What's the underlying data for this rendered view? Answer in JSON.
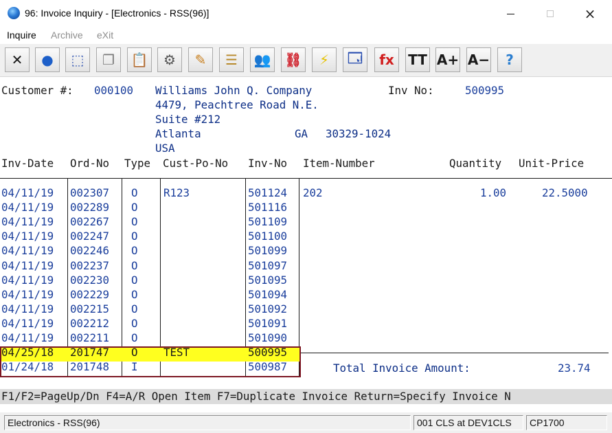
{
  "window": {
    "title": "96: Invoice Inquiry - [Electronics - RSS(96)]",
    "controls": {
      "minimize": "minimize",
      "maximize": "maximize",
      "close": "×"
    }
  },
  "menu": {
    "items": [
      {
        "label": "Inquire",
        "enabled": true
      },
      {
        "label": "Archive",
        "enabled": false
      },
      {
        "label": "eXit",
        "enabled": false
      }
    ]
  },
  "toolbar": {
    "buttons": [
      {
        "icon": "close-x-icon",
        "glyph": "✕",
        "color": "#1a1a1a"
      },
      {
        "icon": "globe-icon",
        "glyph": "●",
        "color": "#1d5fc9"
      },
      {
        "icon": "select-box-icon",
        "glyph": "⬚",
        "color": "#2a4fb0"
      },
      {
        "icon": "copy-icon",
        "glyph": "❐",
        "color": "#7a7a7a"
      },
      {
        "icon": "paste-icon",
        "glyph": "📋",
        "color": "#7a7a7a"
      },
      {
        "icon": "gear-icon",
        "glyph": "⚙",
        "color": "#555555"
      },
      {
        "icon": "edit-pencil-icon",
        "glyph": "✎",
        "color": "#c77d1a"
      },
      {
        "icon": "notepad-icon",
        "glyph": "☰",
        "color": "#b88a2c"
      },
      {
        "icon": "users-icon",
        "glyph": "👥",
        "color": "#2c7fd0"
      },
      {
        "icon": "link-icon",
        "glyph": "⛓",
        "color": "#d0202b"
      },
      {
        "icon": "lightning-icon",
        "glyph": "⚡",
        "color": "#e6c200"
      },
      {
        "icon": "window-lightning-icon",
        "glyph": "🗔",
        "color": "#2a4fb0"
      },
      {
        "icon": "function-fx-icon",
        "glyph": "fx",
        "color": "#d11f1f"
      },
      {
        "icon": "font-tt-icon",
        "glyph": "TT",
        "color": "#1a1a1a"
      },
      {
        "icon": "font-increase-icon",
        "glyph": "A+",
        "color": "#1a1a1a"
      },
      {
        "icon": "font-decrease-icon",
        "glyph": "A−",
        "color": "#1a1a1a"
      },
      {
        "icon": "help-icon",
        "glyph": "?",
        "color": "#2c7fd0"
      }
    ]
  },
  "customer": {
    "label": "Customer #:",
    "number": "000100",
    "name": "Williams John Q. Company",
    "address1": "4479, Peachtree Road N.E.",
    "address2": "Suite #212",
    "city": "Atlanta",
    "state": "GA",
    "zip": "30329-1024",
    "country": "USA"
  },
  "invoice": {
    "label": "Inv No:",
    "number": "500995"
  },
  "columns": {
    "inv_date": "Inv-Date",
    "ord_no": "Ord-No",
    "type": "Type",
    "cust_po_no": "Cust-Po-No",
    "inv_no": "Inv-No",
    "item_number": "Item-Number",
    "quantity": "Quantity",
    "unit_price": "Unit-Price"
  },
  "rows": [
    {
      "inv_date": "04/11/19",
      "ord_no": "002307",
      "type": "O",
      "cust_po_no": "R123",
      "inv_no": "501124"
    },
    {
      "inv_date": "04/11/19",
      "ord_no": "002289",
      "type": "O",
      "cust_po_no": "",
      "inv_no": "501116"
    },
    {
      "inv_date": "04/11/19",
      "ord_no": "002267",
      "type": "O",
      "cust_po_no": "",
      "inv_no": "501109"
    },
    {
      "inv_date": "04/11/19",
      "ord_no": "002247",
      "type": "O",
      "cust_po_no": "",
      "inv_no": "501100"
    },
    {
      "inv_date": "04/11/19",
      "ord_no": "002246",
      "type": "O",
      "cust_po_no": "",
      "inv_no": "501099"
    },
    {
      "inv_date": "04/11/19",
      "ord_no": "002237",
      "type": "O",
      "cust_po_no": "",
      "inv_no": "501097"
    },
    {
      "inv_date": "04/11/19",
      "ord_no": "002230",
      "type": "O",
      "cust_po_no": "",
      "inv_no": "501095"
    },
    {
      "inv_date": "04/11/19",
      "ord_no": "002229",
      "type": "O",
      "cust_po_no": "",
      "inv_no": "501094"
    },
    {
      "inv_date": "04/11/19",
      "ord_no": "002215",
      "type": "O",
      "cust_po_no": "",
      "inv_no": "501092"
    },
    {
      "inv_date": "04/11/19",
      "ord_no": "002212",
      "type": "O",
      "cust_po_no": "",
      "inv_no": "501091"
    },
    {
      "inv_date": "04/11/19",
      "ord_no": "002211",
      "type": "O",
      "cust_po_no": "",
      "inv_no": "501090"
    },
    {
      "inv_date": "04/25/18",
      "ord_no": "201747",
      "type": "O",
      "cust_po_no": "TEST",
      "inv_no": "500995",
      "highlighted": true
    },
    {
      "inv_date": "01/24/18",
      "ord_no": "201748",
      "type": "I",
      "cust_po_no": "",
      "inv_no": "500987"
    }
  ],
  "detail_lines": [
    {
      "item_number": "202",
      "quantity": "1.00",
      "unit_price": "22.5000"
    }
  ],
  "total": {
    "label": "Total Invoice Amount:",
    "value": "23.74"
  },
  "function_keys": "F1/F2=PageUp/Dn F4=A/R Open Item F7=Duplicate Invoice Return=Specify Invoice N",
  "status": {
    "company": "Electronics - RSS(96)",
    "session": "001 CLS at DEV1CLS",
    "codepage": "CP1700"
  },
  "colors": {
    "highlight_row": "#ffff1f",
    "selection_border": "#7c1622",
    "data_text": "#1a3e9c",
    "label_text": "#1a1a1a"
  }
}
